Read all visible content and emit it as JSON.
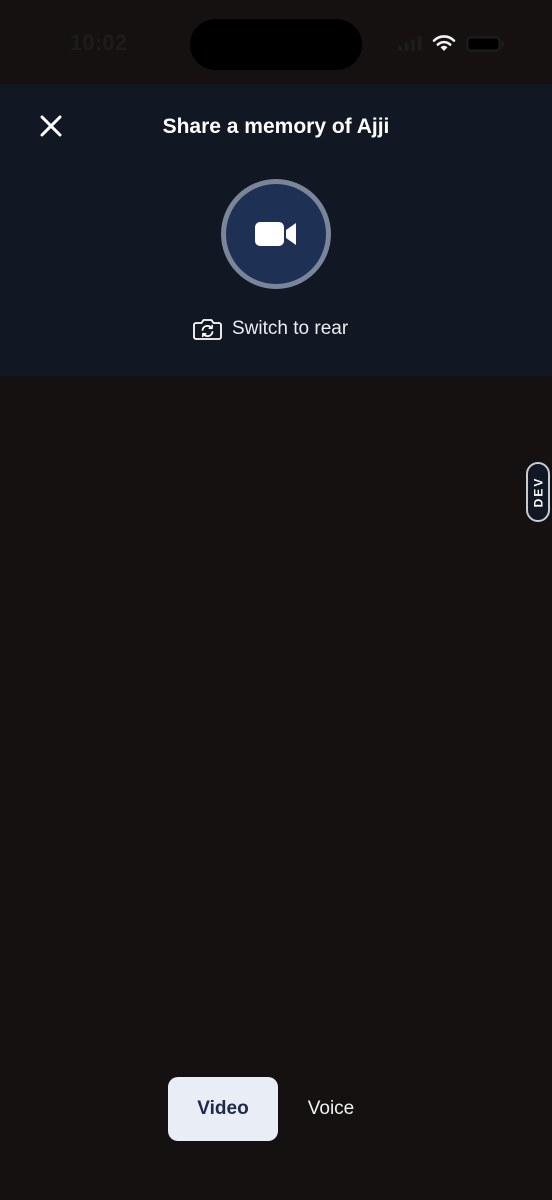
{
  "status_bar": {
    "time": "10:02",
    "icons": [
      "signal-icon",
      "wifi-icon",
      "battery-icon"
    ]
  },
  "header": {
    "title": "Share a memory of Ajji",
    "close_icon": "close-icon"
  },
  "recorder": {
    "record_icon": "video-camera-icon",
    "switch_camera_label": "Switch to rear",
    "switch_camera_icon": "camera-flip-icon"
  },
  "dev_tab": {
    "label": "DEV"
  },
  "mode_switch": {
    "options": [
      {
        "label": "Video",
        "selected": true
      },
      {
        "label": "Voice",
        "selected": false
      }
    ]
  },
  "colors": {
    "background": "#141110",
    "header_background": "#111723",
    "record_button": "#1e3155",
    "record_ring": "#7a8599",
    "selected_mode_bg": "#e9edf6",
    "selected_mode_text": "#1e2a49"
  }
}
